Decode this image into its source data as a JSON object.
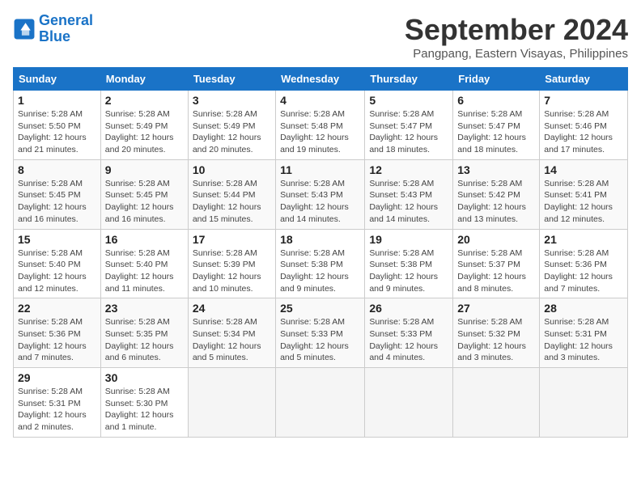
{
  "header": {
    "logo_line1": "General",
    "logo_line2": "Blue",
    "month_title": "September 2024",
    "subtitle": "Pangpang, Eastern Visayas, Philippines"
  },
  "weekdays": [
    "Sunday",
    "Monday",
    "Tuesday",
    "Wednesday",
    "Thursday",
    "Friday",
    "Saturday"
  ],
  "weeks": [
    [
      {
        "day": "1",
        "detail": "Sunrise: 5:28 AM\nSunset: 5:50 PM\nDaylight: 12 hours\nand 21 minutes."
      },
      {
        "day": "2",
        "detail": "Sunrise: 5:28 AM\nSunset: 5:49 PM\nDaylight: 12 hours\nand 20 minutes."
      },
      {
        "day": "3",
        "detail": "Sunrise: 5:28 AM\nSunset: 5:49 PM\nDaylight: 12 hours\nand 20 minutes."
      },
      {
        "day": "4",
        "detail": "Sunrise: 5:28 AM\nSunset: 5:48 PM\nDaylight: 12 hours\nand 19 minutes."
      },
      {
        "day": "5",
        "detail": "Sunrise: 5:28 AM\nSunset: 5:47 PM\nDaylight: 12 hours\nand 18 minutes."
      },
      {
        "day": "6",
        "detail": "Sunrise: 5:28 AM\nSunset: 5:47 PM\nDaylight: 12 hours\nand 18 minutes."
      },
      {
        "day": "7",
        "detail": "Sunrise: 5:28 AM\nSunset: 5:46 PM\nDaylight: 12 hours\nand 17 minutes."
      }
    ],
    [
      {
        "day": "8",
        "detail": "Sunrise: 5:28 AM\nSunset: 5:45 PM\nDaylight: 12 hours\nand 16 minutes."
      },
      {
        "day": "9",
        "detail": "Sunrise: 5:28 AM\nSunset: 5:45 PM\nDaylight: 12 hours\nand 16 minutes."
      },
      {
        "day": "10",
        "detail": "Sunrise: 5:28 AM\nSunset: 5:44 PM\nDaylight: 12 hours\nand 15 minutes."
      },
      {
        "day": "11",
        "detail": "Sunrise: 5:28 AM\nSunset: 5:43 PM\nDaylight: 12 hours\nand 14 minutes."
      },
      {
        "day": "12",
        "detail": "Sunrise: 5:28 AM\nSunset: 5:43 PM\nDaylight: 12 hours\nand 14 minutes."
      },
      {
        "day": "13",
        "detail": "Sunrise: 5:28 AM\nSunset: 5:42 PM\nDaylight: 12 hours\nand 13 minutes."
      },
      {
        "day": "14",
        "detail": "Sunrise: 5:28 AM\nSunset: 5:41 PM\nDaylight: 12 hours\nand 12 minutes."
      }
    ],
    [
      {
        "day": "15",
        "detail": "Sunrise: 5:28 AM\nSunset: 5:40 PM\nDaylight: 12 hours\nand 12 minutes."
      },
      {
        "day": "16",
        "detail": "Sunrise: 5:28 AM\nSunset: 5:40 PM\nDaylight: 12 hours\nand 11 minutes."
      },
      {
        "day": "17",
        "detail": "Sunrise: 5:28 AM\nSunset: 5:39 PM\nDaylight: 12 hours\nand 10 minutes."
      },
      {
        "day": "18",
        "detail": "Sunrise: 5:28 AM\nSunset: 5:38 PM\nDaylight: 12 hours\nand 9 minutes."
      },
      {
        "day": "19",
        "detail": "Sunrise: 5:28 AM\nSunset: 5:38 PM\nDaylight: 12 hours\nand 9 minutes."
      },
      {
        "day": "20",
        "detail": "Sunrise: 5:28 AM\nSunset: 5:37 PM\nDaylight: 12 hours\nand 8 minutes."
      },
      {
        "day": "21",
        "detail": "Sunrise: 5:28 AM\nSunset: 5:36 PM\nDaylight: 12 hours\nand 7 minutes."
      }
    ],
    [
      {
        "day": "22",
        "detail": "Sunrise: 5:28 AM\nSunset: 5:36 PM\nDaylight: 12 hours\nand 7 minutes."
      },
      {
        "day": "23",
        "detail": "Sunrise: 5:28 AM\nSunset: 5:35 PM\nDaylight: 12 hours\nand 6 minutes."
      },
      {
        "day": "24",
        "detail": "Sunrise: 5:28 AM\nSunset: 5:34 PM\nDaylight: 12 hours\nand 5 minutes."
      },
      {
        "day": "25",
        "detail": "Sunrise: 5:28 AM\nSunset: 5:33 PM\nDaylight: 12 hours\nand 5 minutes."
      },
      {
        "day": "26",
        "detail": "Sunrise: 5:28 AM\nSunset: 5:33 PM\nDaylight: 12 hours\nand 4 minutes."
      },
      {
        "day": "27",
        "detail": "Sunrise: 5:28 AM\nSunset: 5:32 PM\nDaylight: 12 hours\nand 3 minutes."
      },
      {
        "day": "28",
        "detail": "Sunrise: 5:28 AM\nSunset: 5:31 PM\nDaylight: 12 hours\nand 3 minutes."
      }
    ],
    [
      {
        "day": "29",
        "detail": "Sunrise: 5:28 AM\nSunset: 5:31 PM\nDaylight: 12 hours\nand 2 minutes."
      },
      {
        "day": "30",
        "detail": "Sunrise: 5:28 AM\nSunset: 5:30 PM\nDaylight: 12 hours\nand 1 minute."
      },
      {
        "day": "",
        "detail": ""
      },
      {
        "day": "",
        "detail": ""
      },
      {
        "day": "",
        "detail": ""
      },
      {
        "day": "",
        "detail": ""
      },
      {
        "day": "",
        "detail": ""
      }
    ]
  ]
}
